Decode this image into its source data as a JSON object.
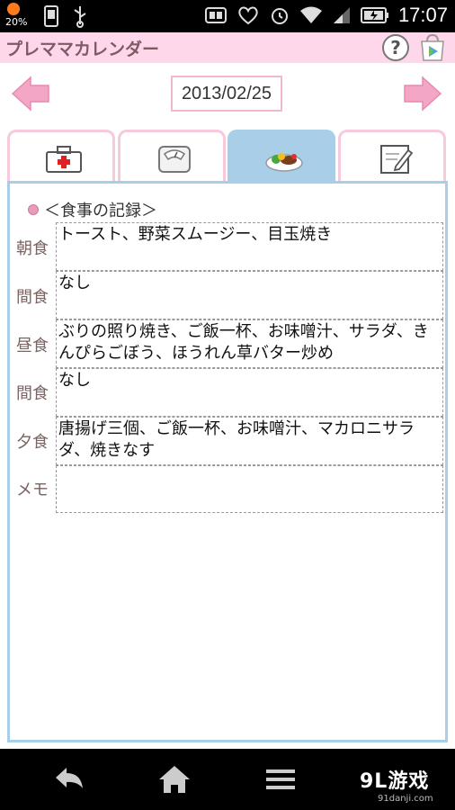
{
  "statusbar": {
    "weather_pct": "20%",
    "time": "17:07",
    "icons": [
      "weather-icon",
      "phone-icon",
      "usb-icon",
      "sim-icon",
      "heart-icon",
      "alarm-icon",
      "wifi-icon",
      "signal-icon",
      "battery-icon"
    ]
  },
  "app": {
    "title": "プレママカレンダー",
    "help_label": "?"
  },
  "date": {
    "value": "2013/02/25"
  },
  "tabs": [
    {
      "icon": "first-aid-kit-icon",
      "active": false
    },
    {
      "icon": "scale-icon",
      "active": false
    },
    {
      "icon": "meal-plate-icon",
      "active": true
    },
    {
      "icon": "notepad-icon",
      "active": false
    }
  ],
  "section": {
    "title": "＜食事の記録＞"
  },
  "meals": [
    {
      "label": "朝食",
      "value": "トースト、野菜スムージー、目玉焼き"
    },
    {
      "label": "間食",
      "value": "なし"
    },
    {
      "label": "昼食",
      "value": "ぶりの照り焼き、ご飯一杯、お味噌汁、サラダ、きんぴらごぼう、ほうれん草バター炒め"
    },
    {
      "label": "間食",
      "value": "なし"
    },
    {
      "label": "夕食",
      "value": "唐揚げ三個、ご飯一杯、お味噌汁、マカロニサラダ、焼きなす"
    },
    {
      "label": "メモ",
      "value": ""
    }
  ],
  "watermark": {
    "brand": "9L游戏",
    "url": "91danji.com"
  },
  "colors": {
    "title_bar": "#ffd7ea",
    "arrow_pink": "#f4a6c6",
    "tab_active": "#a9cfe8",
    "tab_border": "#f6c9dc",
    "panel_border": "#a9cfe8"
  }
}
